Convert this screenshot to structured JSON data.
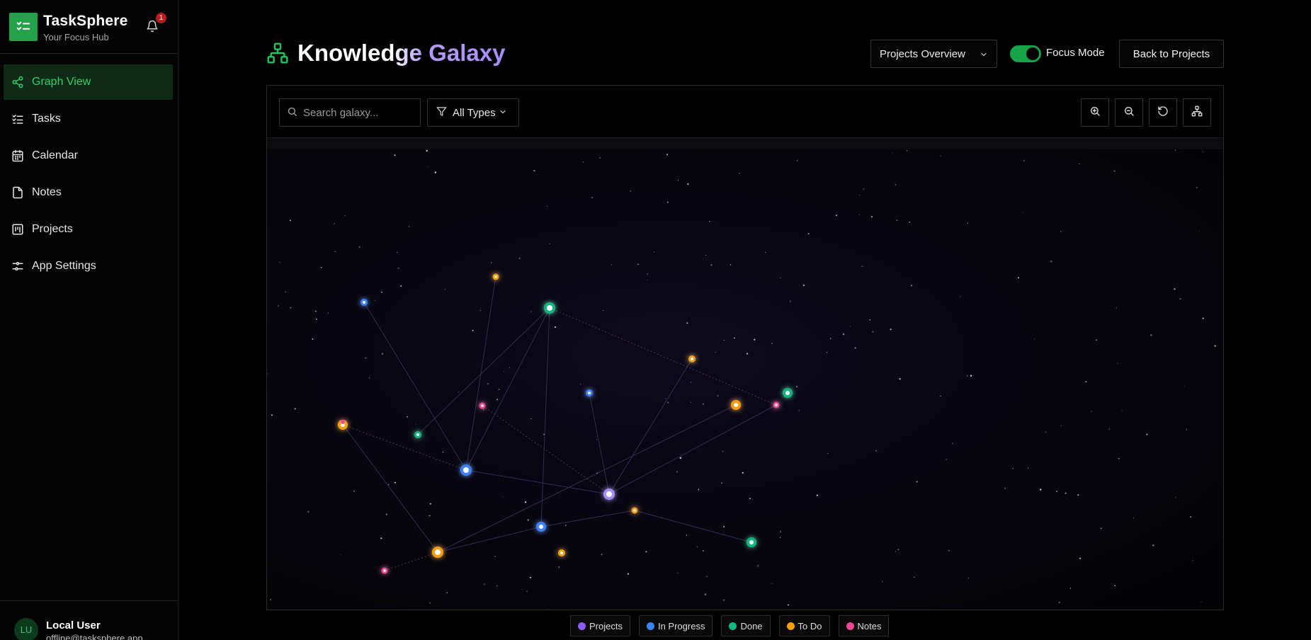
{
  "brand": {
    "name": "TaskSphere",
    "subtitle": "Your Focus Hub",
    "notification_count": "1"
  },
  "nav": [
    {
      "label": "Graph View",
      "icon": "share-graph-icon",
      "active": true
    },
    {
      "label": "Tasks",
      "icon": "list-checks-icon",
      "active": false
    },
    {
      "label": "Calendar",
      "icon": "calendar-icon",
      "active": false
    },
    {
      "label": "Notes",
      "icon": "file-icon",
      "active": false
    },
    {
      "label": "Projects",
      "icon": "kanban-icon",
      "active": false
    },
    {
      "label": "App Settings",
      "icon": "sliders-icon",
      "active": false
    }
  ],
  "user": {
    "initials": "LU",
    "name": "Local User",
    "email": "offline@tasksphere.app"
  },
  "header": {
    "title": "Knowledge Galaxy",
    "view_select": "Projects Overview",
    "focus_mode_label": "Focus Mode",
    "focus_mode_on": true,
    "back_label": "Back to Projects"
  },
  "toolbar": {
    "search_placeholder": "Search galaxy...",
    "filter_label": "All Types",
    "tools": [
      "zoom-in-icon",
      "zoom-out-icon",
      "reset-icon",
      "layout-tree-icon"
    ]
  },
  "colors": {
    "accent": "#22a34a",
    "project": "#a78bfa",
    "in_progress": "#3b82f6",
    "done": "#10b981",
    "todo": "#f59e0b",
    "note": "#ec4899"
  },
  "legend": [
    {
      "label": "Projects",
      "color": "#8b5cf6"
    },
    {
      "label": "In Progress",
      "color": "#3b82f6"
    },
    {
      "label": "Done",
      "color": "#10b981"
    },
    {
      "label": "To Do",
      "color": "#f59e0b"
    },
    {
      "label": "Notes",
      "color": "#ec4899"
    }
  ]
}
